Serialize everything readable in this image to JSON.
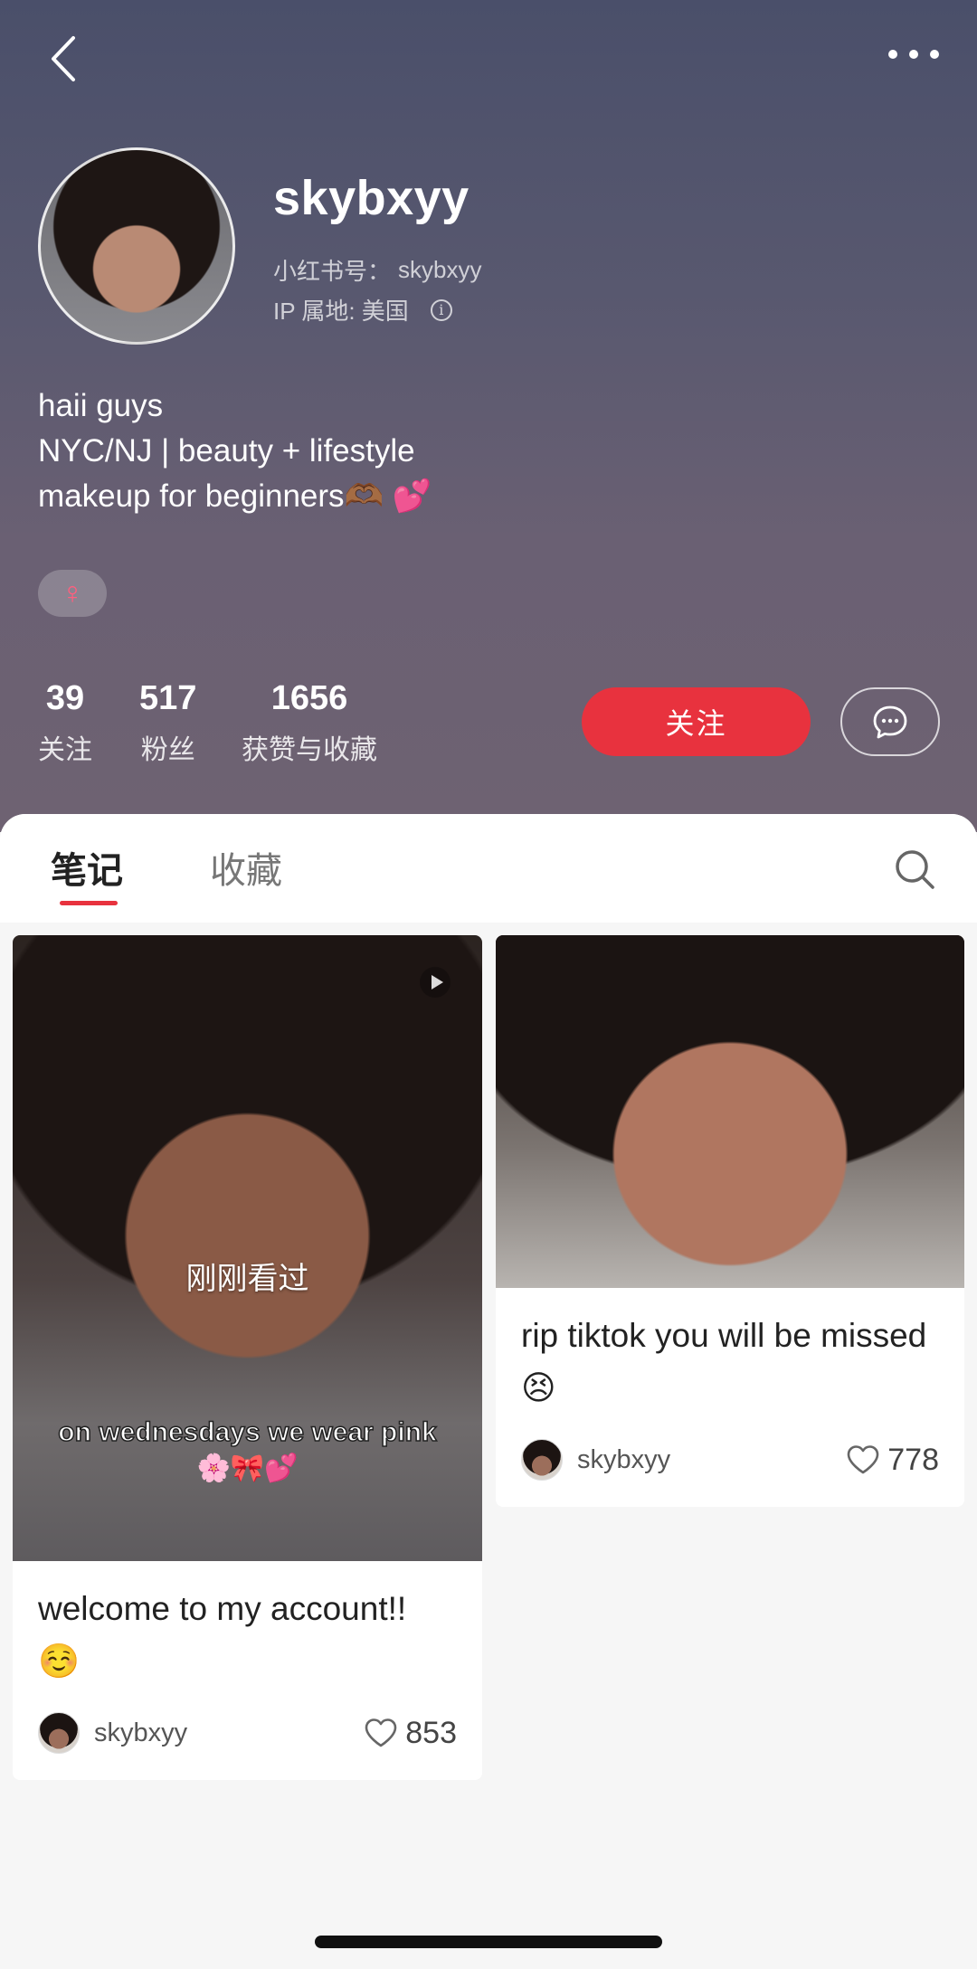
{
  "header": {
    "back_icon": "chevron-left-icon",
    "more_icon": "more-dots-icon"
  },
  "profile": {
    "username": "skybxyy",
    "id_label": "小红书号：",
    "id_value": "skybxyy",
    "ip_label": "IP 属地: 美国",
    "bio_lines": [
      "haii guys",
      "NYC/NJ | beauty + lifestyle",
      "makeup for beginners🫶🏾 💕"
    ],
    "gender_symbol": "♀",
    "gender_color": "#ff5f7e"
  },
  "stats": [
    {
      "value": "39",
      "label": "关注"
    },
    {
      "value": "517",
      "label": "粉丝"
    },
    {
      "value": "1656",
      "label": "获赞与收藏"
    }
  ],
  "actions": {
    "follow_label": "关注",
    "follow_color": "#e8323e",
    "message_icon": "chat-bubble-icon"
  },
  "tabs": {
    "notes": "笔记",
    "collections": "收藏",
    "search_icon": "search-icon"
  },
  "posts": [
    {
      "viewed_label": "刚刚看过",
      "caption": "on wednesdays we wear pink 🌸🎀💕",
      "title": "welcome to my account!! ☺️",
      "author": "skybxyy",
      "likes": "853",
      "is_video": true
    },
    {
      "title": "rip tiktok you will be missed 😣",
      "author": "skybxyy",
      "likes": "778",
      "is_video": false
    }
  ]
}
